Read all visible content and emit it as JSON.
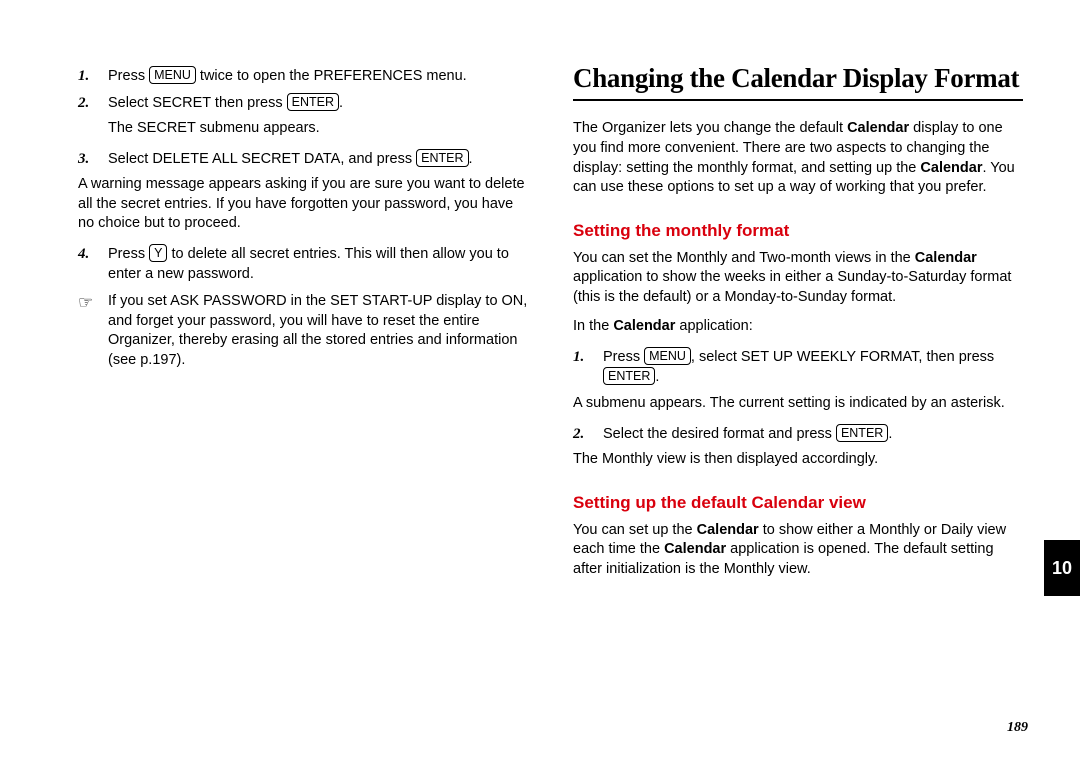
{
  "left": {
    "steps": [
      {
        "num": "1.",
        "pre": "Press ",
        "key": "MENU",
        "post": " twice to open the PREFERENCES menu."
      },
      {
        "num": "2.",
        "pre": "Select SECRET then press ",
        "key": "ENTER",
        "post": "."
      }
    ],
    "afterStep2": "The SECRET submenu appears.",
    "step3": {
      "num": "3.",
      "pre": "Select DELETE ALL SECRET DATA, and press ",
      "key": "ENTER",
      "post": "."
    },
    "warn": "A warning message appears asking if you are sure you want to delete all the secret entries. If you have forgotten your password, you have no choice but to proceed.",
    "step4": {
      "num": "4.",
      "pre": "Press ",
      "key": "Y",
      "post": " to delete all secret entries. This will then allow you to enter a new password."
    },
    "noteIcon": "☞",
    "note": "If you set ASK PASSWORD in the SET START-UP display to ON, and forget your password, you will have to reset the entire Organizer, thereby erasing all the stored entries and information (see p.197)."
  },
  "right": {
    "title": "Changing the Calendar Display Format",
    "intro": {
      "t1": "The Organizer lets you change the default ",
      "b1": "Calendar",
      "t2": " display to one you find more convenient. There are two aspects to changing the display: setting the monthly format, and setting up the ",
      "b2": "Calendar",
      "t3": ". You can use these options to set up a way of working that you prefer."
    },
    "sub1": "Setting the monthly format",
    "sub1body": {
      "t1": "You can set the Monthly and Two-month views in the ",
      "b1": "Calendar",
      "t2": " application to show the weeks in either a Sunday-to-Saturday format (this is the default) or a Monday-to-Sunday format."
    },
    "inApp": {
      "t1": "In the ",
      "b1": "Calendar",
      "t2": " application:"
    },
    "r_step1": {
      "num": "1.",
      "pre": "Press ",
      "key1": "MENU",
      "mid": ", select SET UP WEEKLY FORMAT, then press ",
      "key2": "ENTER",
      "post": "."
    },
    "afterR1": "A submenu appears. The current setting is indicated by an asterisk.",
    "r_step2": {
      "num": "2.",
      "pre": "Select the desired format and press ",
      "key": "ENTER",
      "post": "."
    },
    "afterR2": "The Monthly view is then displayed accordingly.",
    "sub2": "Setting up the default Calendar view",
    "sub2body": {
      "t1": "You can set up the ",
      "b1": "Calendar",
      "t2": " to show either a Monthly or Daily view each time the ",
      "b2": "Calendar",
      "t3": " application is opened. The default setting after initialization is the Monthly view."
    }
  },
  "tab": "10",
  "pageNumber": "189",
  "chart_data": null
}
